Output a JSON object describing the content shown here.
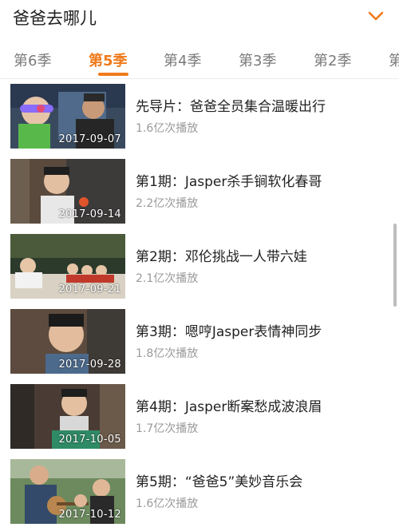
{
  "header": {
    "title": "爸爸去哪儿",
    "expand_icon": "chevron-down-icon",
    "accent": "#f07a1a"
  },
  "tabs": [
    {
      "label": "第6季",
      "active": false
    },
    {
      "label": "第5季",
      "active": true
    },
    {
      "label": "第4季",
      "active": false
    },
    {
      "label": "第3季",
      "active": false
    },
    {
      "label": "第2季",
      "active": false
    },
    {
      "label": "第",
      "active": false
    }
  ],
  "episodes": [
    {
      "title": "先导片：爸爸全员集合温暖出行",
      "plays": "1.6亿次播放",
      "date": "2017-09-07"
    },
    {
      "title": "第1期：Jasper杀手锏软化春哥",
      "plays": "2.2亿次播放",
      "date": "2017-09-14"
    },
    {
      "title": "第2期：邓伦挑战一人带六娃",
      "plays": "2.1亿次播放",
      "date": "2017-09-21"
    },
    {
      "title": "第3期：嗯哼Jasper表情神同步",
      "plays": "1.8亿次播放",
      "date": "2017-09-28"
    },
    {
      "title": "第4期：Jasper断案愁成波浪眉",
      "plays": "1.7亿次播放",
      "date": "2017-10-05"
    },
    {
      "title": "第5期：“爸爸5”美妙音乐会",
      "plays": "1.6亿次播放",
      "date": "2017-10-12"
    }
  ]
}
